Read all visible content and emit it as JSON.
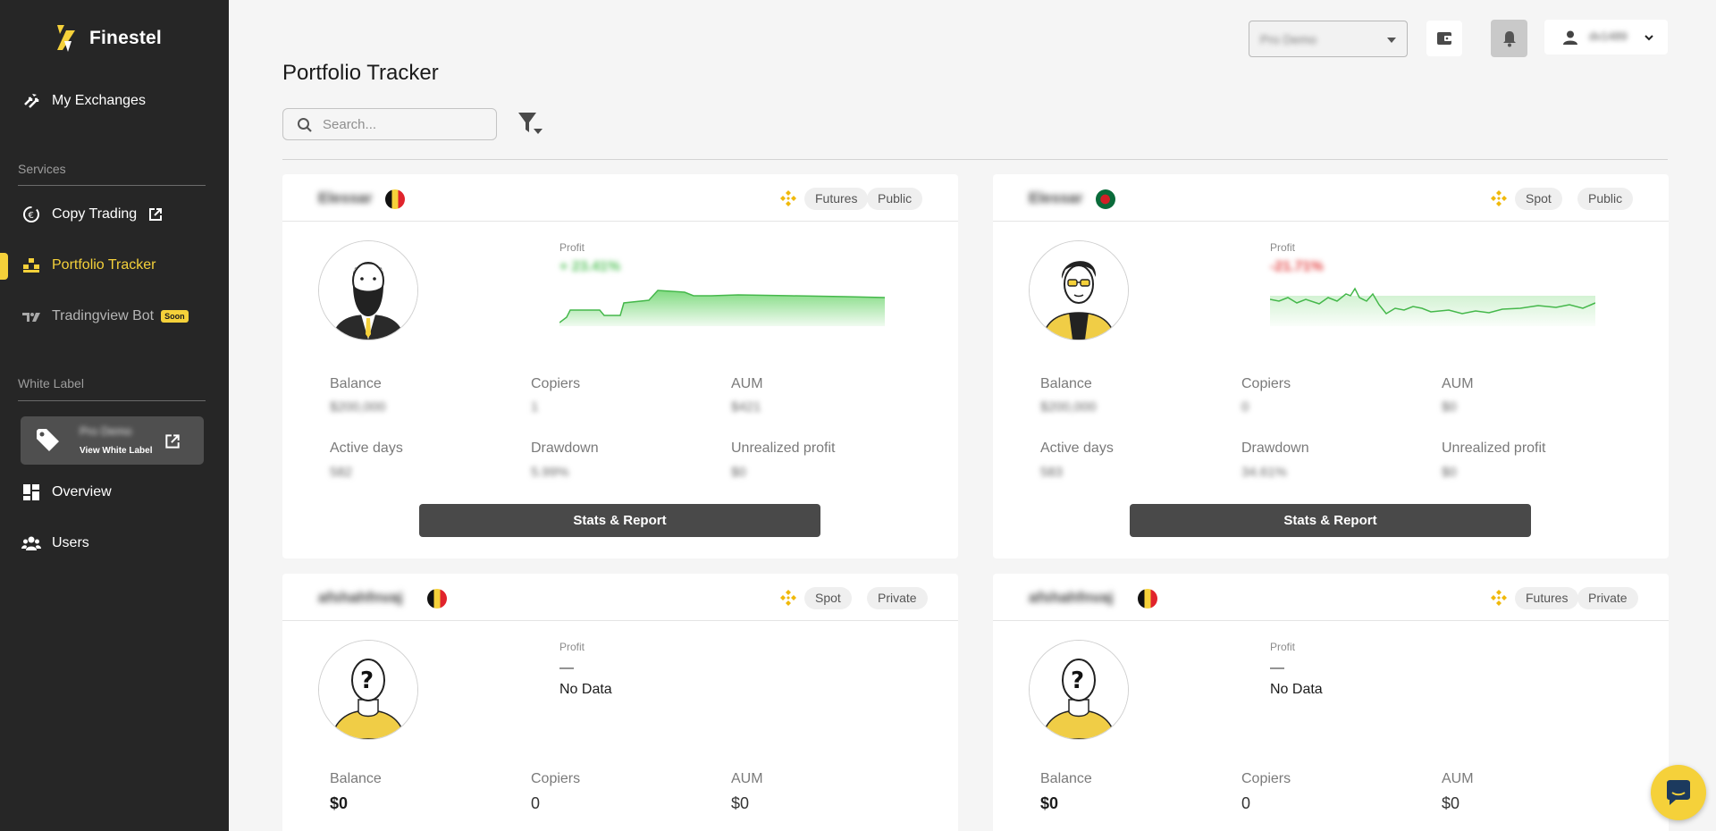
{
  "app": {
    "name": "Finestel"
  },
  "sidebar": {
    "my_exchanges": "My Exchanges",
    "services_label": "Services",
    "copy_trading": "Copy Trading",
    "portfolio_tracker": "Portfolio Tracker",
    "tradingview_bot": "Tradingview Bot",
    "soon_badge": "Soon",
    "white_label_label": "White Label",
    "white_label_name": "Pro Demo",
    "view_white_label": "View White Label",
    "overview": "Overview",
    "users": "Users"
  },
  "topbar": {
    "plan_select_value": "Pro Demo",
    "username": "dv1489"
  },
  "page": {
    "title": "Portfolio Tracker",
    "search_placeholder": "Search..."
  },
  "labels": {
    "profit": "Profit",
    "balance": "Balance",
    "copiers": "Copiers",
    "aum": "AUM",
    "active_days": "Active days",
    "drawdown": "Drawdown",
    "unrealized_profit": "Unrealized profit",
    "stats_report": "Stats & Report",
    "no_data": "No Data",
    "dash": "—"
  },
  "cards": [
    {
      "name": "Elessar",
      "market": "Futures",
      "visibility": "Public",
      "profit": "+ 23.41%",
      "balance": "$200,000",
      "copiers": "1",
      "aum": "$421",
      "active_days": "582",
      "drawdown": "5.99%",
      "unrealized_profit": "$0",
      "accent": "#54c25a"
    },
    {
      "name": "Elessar",
      "market": "Spot",
      "visibility": "Public",
      "profit": "-21.71%",
      "balance": "$200,000",
      "copiers": "0",
      "aum": "$0",
      "active_days": "583",
      "drawdown": "34.61%",
      "unrealized_profit": "$0",
      "accent": "#e23d3d"
    },
    {
      "name": "afshahfnvaj",
      "market": "Spot",
      "visibility": "Private",
      "balance": "$0",
      "copiers": "0",
      "aum": "$0"
    },
    {
      "name": "afshahfnvaj",
      "market": "Futures",
      "visibility": "Private",
      "balance": "$0",
      "copiers": "0",
      "aum": "$0"
    }
  ],
  "colors": {
    "accent": "#f5d13a",
    "sidebar": "#262626",
    "button": "#494949"
  }
}
